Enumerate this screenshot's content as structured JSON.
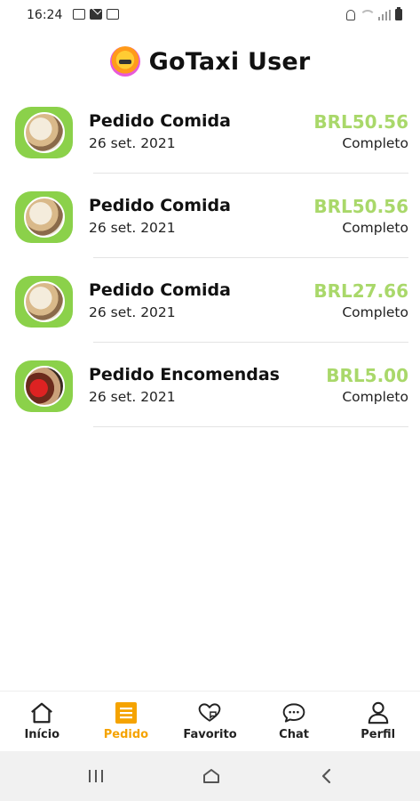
{
  "status_bar": {
    "time": "16:24"
  },
  "header": {
    "title": "GoTaxi User"
  },
  "orders": [
    {
      "title": "Pedido Comida",
      "date": "26 set. 2021",
      "price": "BRL50.56",
      "status": "Completo"
    },
    {
      "title": "Pedido Comida",
      "date": "26 set. 2021",
      "price": "BRL50.56",
      "status": "Completo"
    },
    {
      "title": "Pedido Comida",
      "date": "26 set. 2021",
      "price": "BRL27.66",
      "status": "Completo"
    },
    {
      "title": "Pedido Encomendas",
      "date": "26 set. 2021",
      "price": "BRL5.00",
      "status": "Completo"
    }
  ],
  "bottom_nav": {
    "tabs": [
      {
        "label": "Início",
        "icon": "home-icon"
      },
      {
        "label": "Pedido",
        "icon": "list-icon",
        "active": true
      },
      {
        "label": "Favorito",
        "icon": "heart-chat-icon"
      },
      {
        "label": "Chat",
        "icon": "chat-bubble-icon"
      },
      {
        "label": "Perfil",
        "icon": "user-icon"
      }
    ]
  },
  "colors": {
    "accent_green": "#a9d86a",
    "thumb_green": "#8bd14a",
    "active_tab": "#f5a300"
  }
}
